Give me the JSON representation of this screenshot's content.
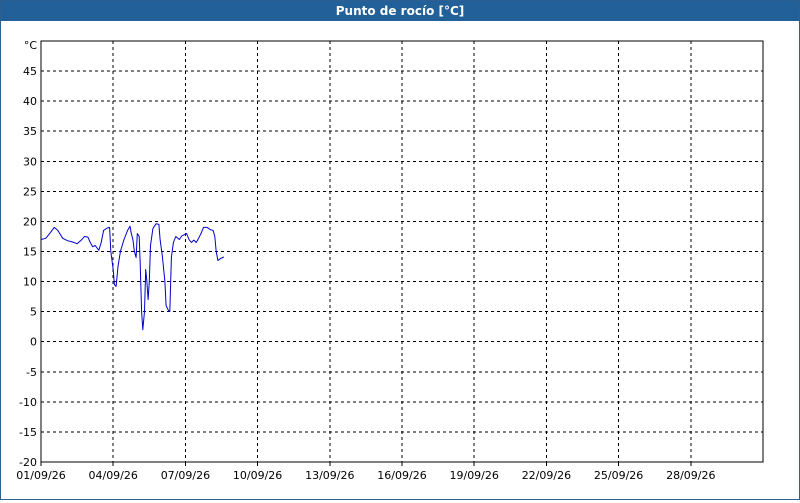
{
  "window": {
    "title": "Punto de rocío [°C]"
  },
  "chart_data": {
    "type": "line",
    "title": "Punto de rocío [°C]",
    "unit_label": "°C",
    "xlabel": "",
    "ylabel": "",
    "x_ticks": [
      "01/09/26",
      "04/09/26",
      "07/09/26",
      "10/09/26",
      "13/09/26",
      "16/09/26",
      "19/09/26",
      "22/09/26",
      "25/09/26",
      "28/09/26"
    ],
    "xlim_days": [
      1,
      31
    ],
    "ylim": [
      -20,
      50
    ],
    "y_ticks": [
      -20,
      -15,
      -10,
      -5,
      0,
      5,
      10,
      15,
      20,
      25,
      30,
      35,
      40,
      45
    ],
    "grid": true,
    "legend": "none",
    "series": [
      {
        "color": "#0000cc",
        "points": [
          [
            1.0,
            17.0
          ],
          [
            1.2,
            17.2
          ],
          [
            1.4,
            18.2
          ],
          [
            1.55,
            19.0
          ],
          [
            1.7,
            18.5
          ],
          [
            1.9,
            17.2
          ],
          [
            2.1,
            16.8
          ],
          [
            2.3,
            16.6
          ],
          [
            2.5,
            16.3
          ],
          [
            2.7,
            17.0
          ],
          [
            2.8,
            17.5
          ],
          [
            2.95,
            17.4
          ],
          [
            3.05,
            16.5
          ],
          [
            3.15,
            15.8
          ],
          [
            3.25,
            16.0
          ],
          [
            3.4,
            15.2
          ],
          [
            3.5,
            16.5
          ],
          [
            3.6,
            18.5
          ],
          [
            3.75,
            18.9
          ],
          [
            3.85,
            19.0
          ],
          [
            3.9,
            15.0
          ],
          [
            4.0,
            12.0
          ],
          [
            4.05,
            9.5
          ],
          [
            4.12,
            9.2
          ],
          [
            4.2,
            12.5
          ],
          [
            4.3,
            15.0
          ],
          [
            4.45,
            17.0
          ],
          [
            4.6,
            18.5
          ],
          [
            4.7,
            19.2
          ],
          [
            4.75,
            18.0
          ],
          [
            4.82,
            17.0
          ],
          [
            4.88,
            15.0
          ],
          [
            4.95,
            14.0
          ],
          [
            5.0,
            18.0
          ],
          [
            5.08,
            17.5
          ],
          [
            5.12,
            13.0
          ],
          [
            5.18,
            5.0
          ],
          [
            5.23,
            2.0
          ],
          [
            5.3,
            5.0
          ],
          [
            5.35,
            12.0
          ],
          [
            5.4,
            10.0
          ],
          [
            5.45,
            7.0
          ],
          [
            5.5,
            10.0
          ],
          [
            5.55,
            16.0
          ],
          [
            5.65,
            18.8
          ],
          [
            5.78,
            19.6
          ],
          [
            5.9,
            19.5
          ],
          [
            5.95,
            17.0
          ],
          [
            6.05,
            14.0
          ],
          [
            6.15,
            10.0
          ],
          [
            6.2,
            6.0
          ],
          [
            6.28,
            5.3
          ],
          [
            6.35,
            5.0
          ],
          [
            6.42,
            14.0
          ],
          [
            6.5,
            16.5
          ],
          [
            6.6,
            17.5
          ],
          [
            6.75,
            17.0
          ],
          [
            6.85,
            17.6
          ],
          [
            6.95,
            17.8
          ],
          [
            7.05,
            18.0
          ],
          [
            7.15,
            17.0
          ],
          [
            7.25,
            16.5
          ],
          [
            7.35,
            16.9
          ],
          [
            7.45,
            16.5
          ],
          [
            7.55,
            17.2
          ],
          [
            7.65,
            18.0
          ],
          [
            7.75,
            19.0
          ],
          [
            7.9,
            19.0
          ],
          [
            8.05,
            18.6
          ],
          [
            8.15,
            18.5
          ],
          [
            8.22,
            17.5
          ],
          [
            8.28,
            15.0
          ],
          [
            8.35,
            13.5
          ],
          [
            8.45,
            13.8
          ],
          [
            8.55,
            14.0
          ],
          [
            8.6,
            14.1
          ]
        ]
      }
    ]
  }
}
